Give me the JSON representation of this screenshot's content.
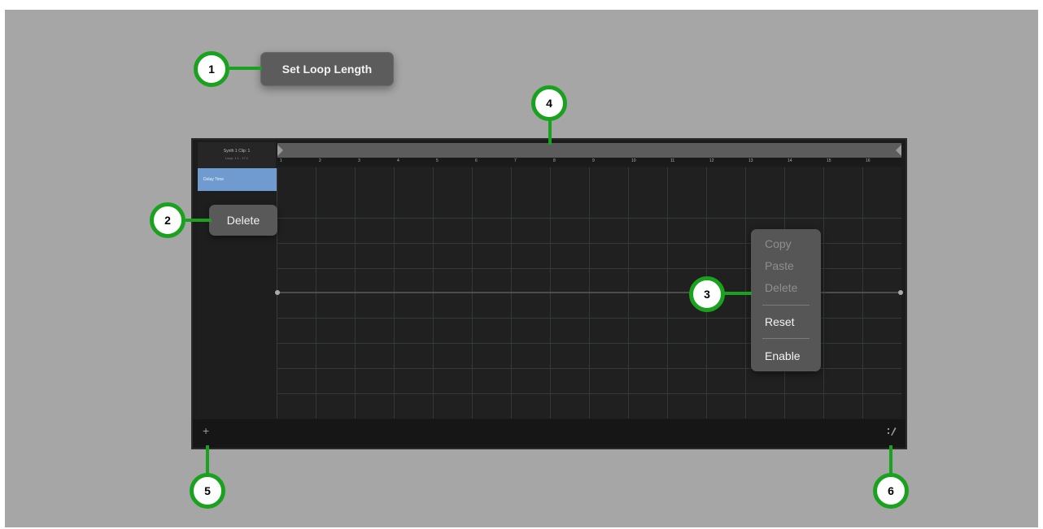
{
  "loop_button": {
    "label": "Set Loop Length"
  },
  "track": {
    "title": "Synth 1 Clip: 1",
    "subtitle": "Loop: 1.1 - 17.1"
  },
  "parameter": {
    "label": "Delay Time"
  },
  "delete_button": {
    "label": "Delete"
  },
  "ruler": {
    "bars": [
      "1",
      "2",
      "3",
      "4",
      "5",
      "6",
      "7",
      "8",
      "9",
      "10",
      "11",
      "12",
      "13",
      "14",
      "15",
      "16"
    ]
  },
  "context_menu": {
    "items": [
      {
        "label": "Copy",
        "enabled": false
      },
      {
        "label": "Paste",
        "enabled": false
      },
      {
        "label": "Delete",
        "enabled": false
      },
      {
        "label": "Reset",
        "enabled": true
      },
      {
        "label": "Enable",
        "enabled": true
      }
    ]
  },
  "bottom_bar": {
    "add_label": "+",
    "settings_icon": "automation-settings-icon"
  },
  "callouts": [
    "1",
    "2",
    "3",
    "4",
    "5",
    "6"
  ],
  "colors": {
    "callout_green": "#1aa21f",
    "selected_param": "#6f9bd1",
    "background": "#a6a6a6"
  }
}
